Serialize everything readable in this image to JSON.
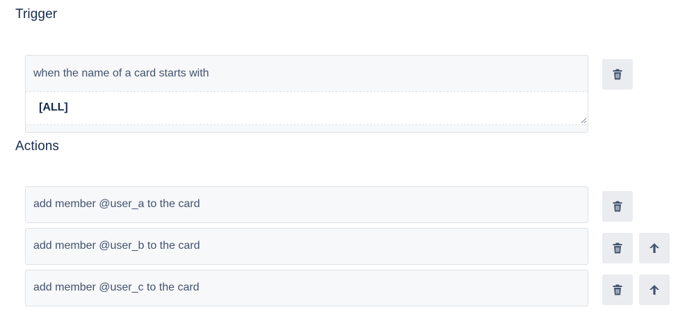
{
  "trigger": {
    "title": "Trigger",
    "condition_text": "when the name of a card starts with",
    "input_value": "[ALL]"
  },
  "actions": {
    "title": "Actions",
    "items": [
      {
        "label": "add member @user_a to the card"
      },
      {
        "label": "add member @user_b to the card"
      },
      {
        "label": "add member @user_c to the card"
      }
    ]
  },
  "icons": {
    "delete": "trash-icon",
    "move_up": "arrow-up-icon"
  },
  "colors": {
    "heading": "#172b4d",
    "text": "#42526e",
    "box_bg": "#f7f8f9",
    "button_bg": "#ebecf0",
    "icon": "#42526e"
  }
}
